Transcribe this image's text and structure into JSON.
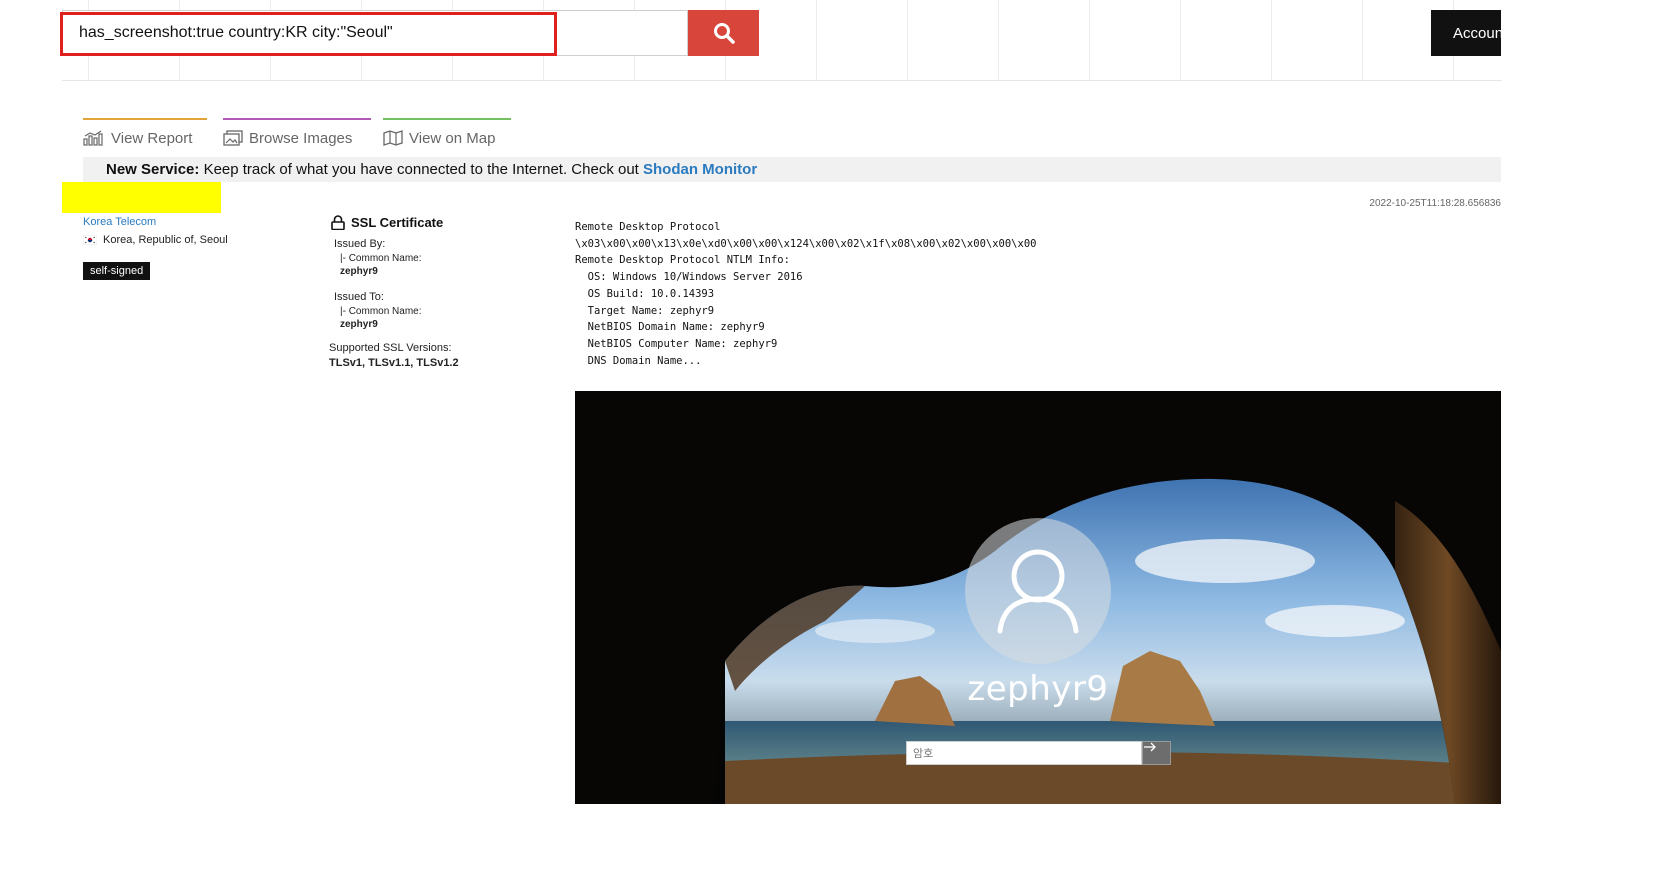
{
  "search": {
    "query": "has_screenshot:true country:KR city:\"Seoul\""
  },
  "header": {
    "account_label": "Account"
  },
  "tabs": [
    {
      "label": "View Report"
    },
    {
      "label": "Browse Images"
    },
    {
      "label": "View on Map"
    }
  ],
  "notice": {
    "prefix": "New Service:",
    "text": "Keep track of what you have connected to the Internet. Check out",
    "link": "Shodan Monitor"
  },
  "host": {
    "timestamp": "2022-10-25T11:18:28.656836",
    "isp": "Korea Telecom",
    "location": "Korea, Republic of, Seoul",
    "tag": "self-signed"
  },
  "ssl": {
    "title": "SSL Certificate",
    "issued_by_label": "Issued By:",
    "issued_by_cn_label": "|- Common Name:",
    "issued_by_cn": "zephyr9",
    "issued_to_label": "Issued To:",
    "issued_to_cn_label": "|- Common Name:",
    "issued_to_cn": "zephyr9",
    "versions_label": "Supported SSL Versions:",
    "versions": "TLSv1, TLSv1.1, TLSv1.2"
  },
  "service": {
    "banner": "Remote Desktop Protocol\n\\x03\\x00\\x00\\x13\\x0e\\xd0\\x00\\x00\\x124\\x00\\x02\\x1f\\x08\\x00\\x02\\x00\\x00\\x00\nRemote Desktop Protocol NTLM Info:\n  OS: Windows 10/Windows Server 2016\n  OS Build: 10.0.14393\n  Target Name: zephyr9\n  NetBIOS Domain Name: zephyr9\n  NetBIOS Computer Name: zephyr9\n  DNS Domain Name..."
  },
  "screenshot": {
    "username": "zephyr9",
    "password_placeholder": "암호"
  },
  "colors": {
    "search_button": "#d8453a",
    "query_highlight": "#e0201f",
    "link": "#2a7bbf",
    "redaction": "#ffff00"
  }
}
